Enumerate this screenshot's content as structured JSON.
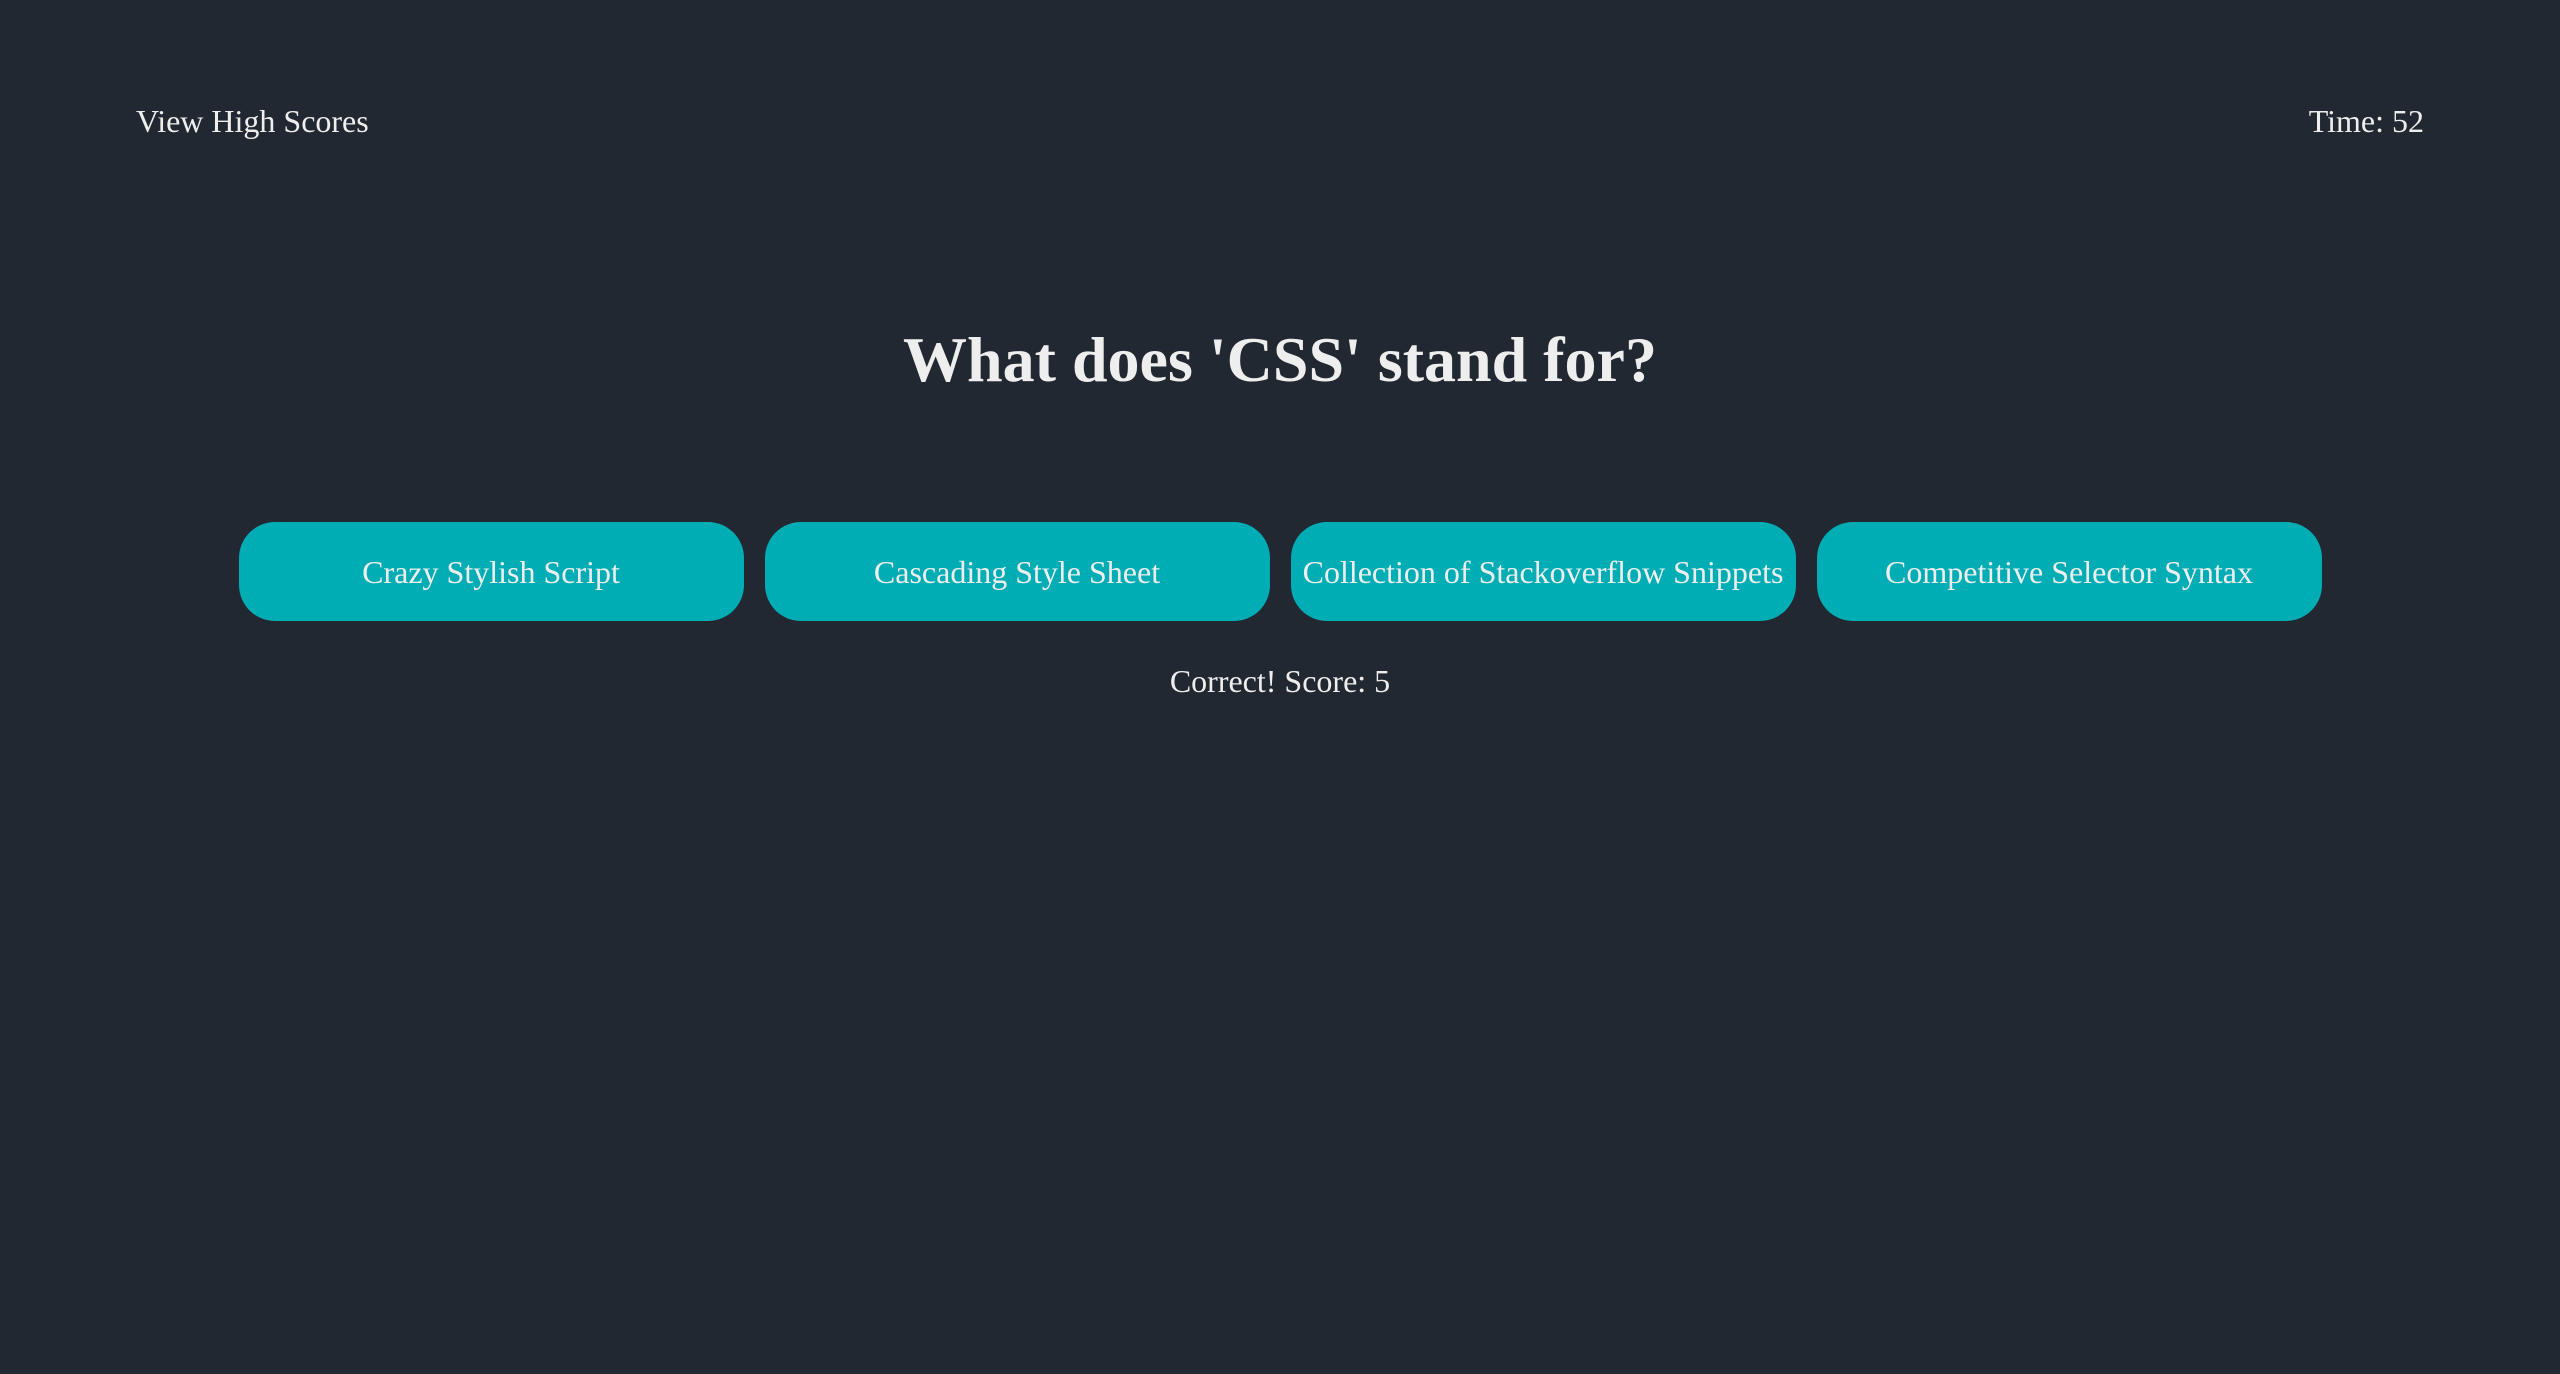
{
  "header": {
    "high_scores_label": "View High Scores",
    "timer_text": "Time: 52"
  },
  "quiz": {
    "question": "What does 'CSS' stand for?",
    "choices": [
      "Crazy Stylish Script",
      "Cascading Style Sheet",
      "Collection of Stackoverflow Snippets",
      "Competitive Selector Syntax"
    ],
    "feedback": "Correct! Score: 5"
  },
  "colors": {
    "background": "#222831",
    "accent": "#00adb5",
    "text": "#eeeeee"
  }
}
